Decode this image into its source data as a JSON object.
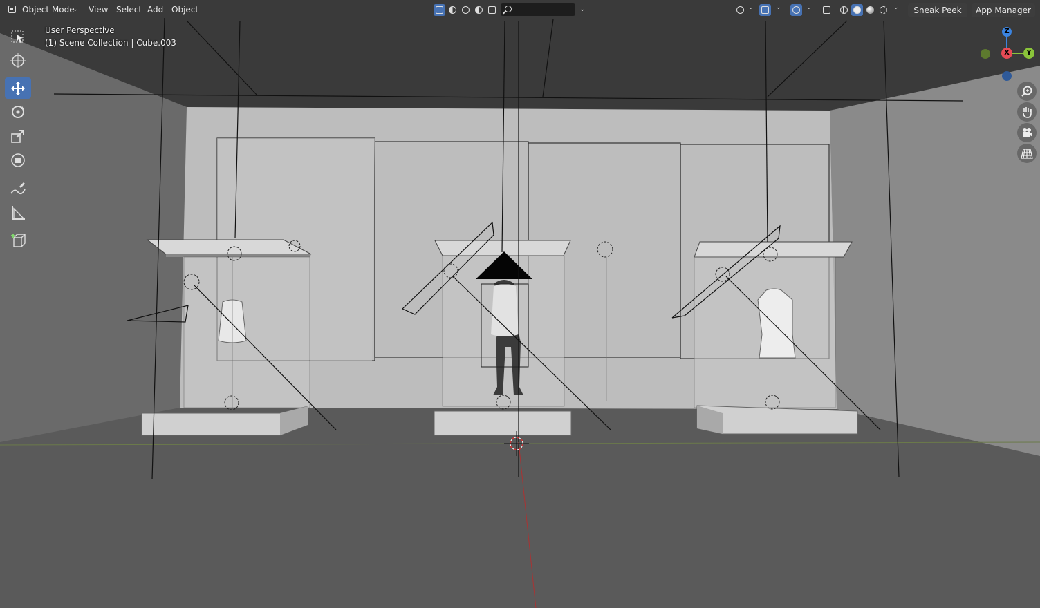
{
  "header": {
    "mode_label": "Object Mode",
    "menus": [
      "View",
      "Select",
      "Add",
      "Object"
    ],
    "sneak_peek_label": "Sneak Peek",
    "app_manager_label": "App Manager",
    "selection_mode_icons": [
      "select-new-icon",
      "select-extend-icon",
      "select-subtract-icon",
      "select-difference-icon",
      "select-intersect-icon"
    ],
    "shading_icons": [
      "wireframe-shading-icon",
      "solid-shading-icon",
      "material-preview-icon",
      "rendered-shading-icon"
    ],
    "active_shading": "solid-shading-icon"
  },
  "toolbar": {
    "tools": [
      "select-box-icon",
      "cursor-icon",
      "move-icon",
      "rotate-icon",
      "scale-icon",
      "transform-icon",
      "annotate-icon",
      "measure-icon",
      "add-cube-icon"
    ],
    "active_tool": "move-icon"
  },
  "viewport": {
    "view_name": "User Perspective",
    "collection_info": "(1) Scene Collection | Cube.003"
  },
  "gizmo": {
    "axes": [
      "Z",
      "X",
      "Y"
    ],
    "axis_colors": {
      "x": "#e84a55",
      "y": "#8ac43a",
      "z": "#3b84e0"
    },
    "nav_buttons": [
      "zoom-icon",
      "pan-hand-icon",
      "camera-view-icon",
      "orthographic-grid-icon"
    ]
  },
  "colors": {
    "accent": "#4772b3",
    "header_bg": "#3a3a3a",
    "wall": "#b9b9b9",
    "floor": "#5c5c5c"
  }
}
